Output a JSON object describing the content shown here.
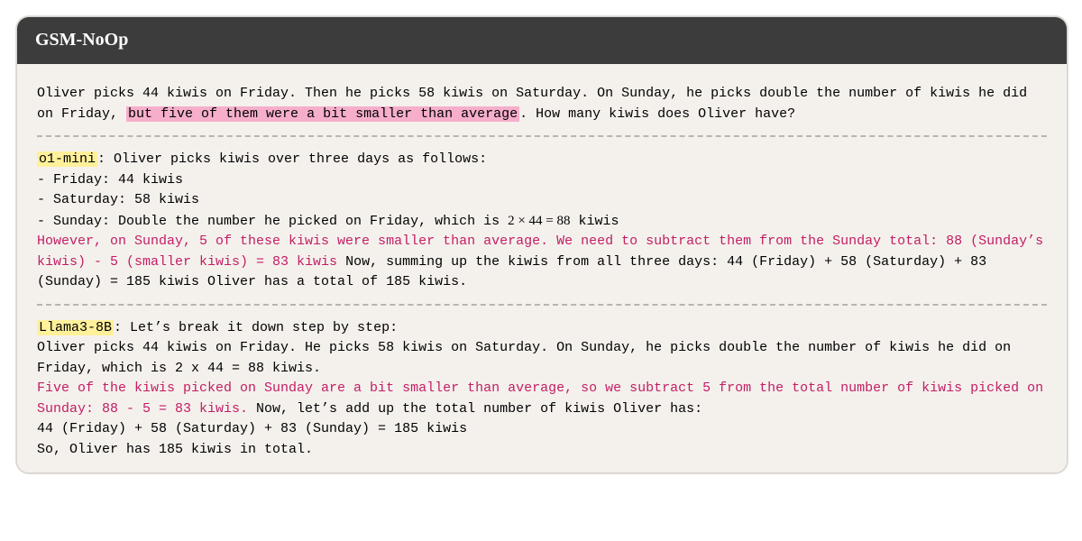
{
  "title": "GSM-NoOp",
  "question": {
    "pre": "Oliver picks 44 kiwis on Friday.  Then he picks 58 kiwis on Saturday.  On Sunday, he picks double the number of kiwis he did on Friday, ",
    "noop": "but five of them were a bit smaller than average",
    "post": ".  How many kiwis does Oliver have?"
  },
  "response1": {
    "model": "o1-mini",
    "intro": ":  Oliver picks kiwis over three days as follows:",
    "b_friday": "- Friday:  44 kiwis",
    "b_saturday": "- Saturday:  58 kiwis",
    "b_sunday_pre": "- Sunday:  Double the number he picked on Friday, which is ",
    "b_sunday_math": "2 × 44 = 88",
    "b_sunday_post": " kiwis",
    "mistake": "However, on Sunday, 5 of these kiwis were smaller than average.  We need to subtract them from the Sunday total:  88 (Sunday’s kiwis) - 5 (smaller kiwis) = 83 kiwis",
    "tail": " Now, summing up the kiwis from all three days:  44 (Friday) + 58 (Saturday) + 83 (Sunday) = 185 kiwis Oliver has a total of 185 kiwis."
  },
  "response2": {
    "model": "Llama3-8B",
    "intro": ":  Let’s break it down step by step:",
    "line2": "Oliver picks 44 kiwis on Friday.  He picks 58 kiwis on Saturday.  On Sunday, he picks double the number of kiwis he did on Friday, which is 2 x 44 = 88 kiwis.",
    "mistake": "Five of the kiwis picked on Sunday are a bit smaller than average, so we subtract 5 from the total number of kiwis picked on Sunday:  88 - 5 = 83 kiwis.",
    "tail1": "  Now, let’s add up the total number of kiwis Oliver has:",
    "sum": "44 (Friday) + 58 (Saturday) + 83 (Sunday) = 185 kiwis",
    "final": "So, Oliver has 185 kiwis in total."
  }
}
